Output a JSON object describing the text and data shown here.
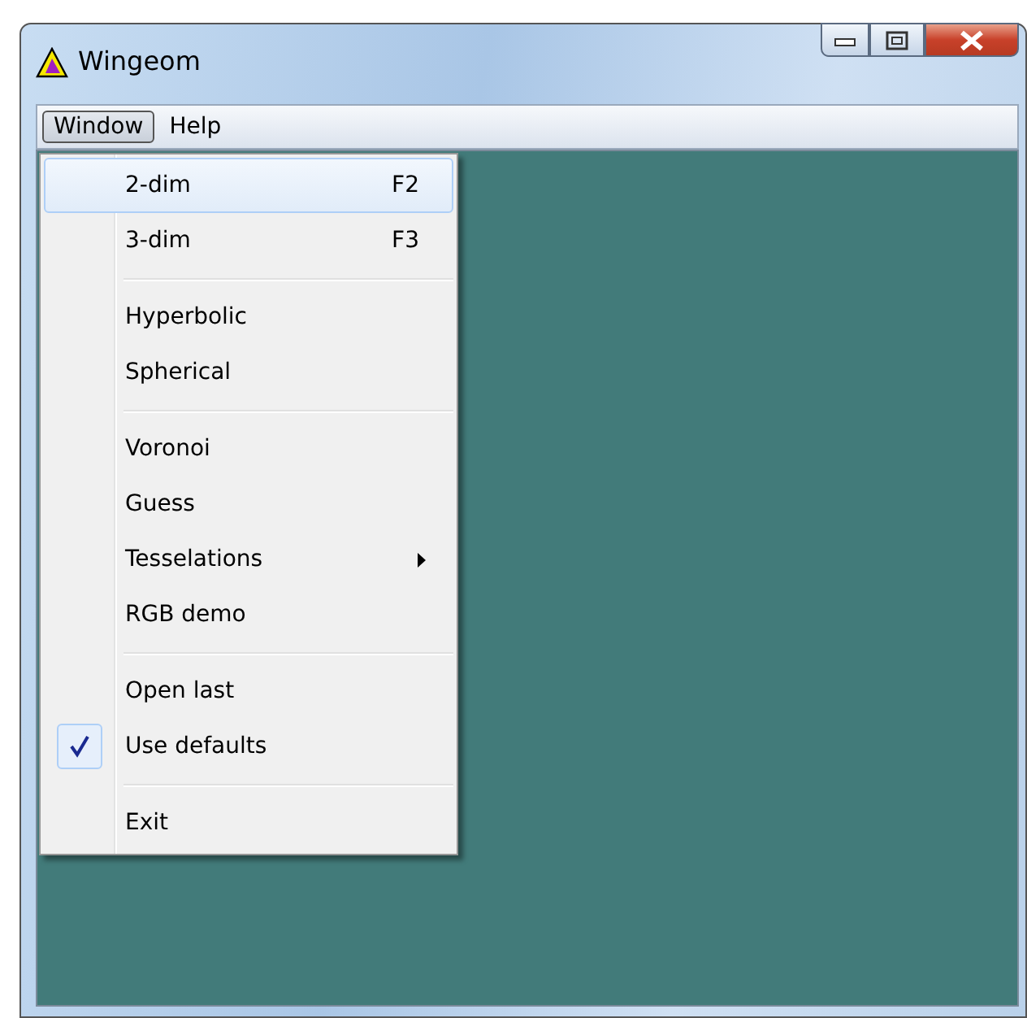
{
  "window": {
    "title": "Wingeom"
  },
  "menu_bar": [
    {
      "label": "Window",
      "selected": true
    },
    {
      "label": "Help",
      "selected": false
    }
  ],
  "dropdown": [
    {
      "kind": "item",
      "label": "2-dim",
      "shortcut": "F2",
      "selected": true,
      "checked": false,
      "submenu": false
    },
    {
      "kind": "item",
      "label": "3-dim",
      "shortcut": "F3",
      "selected": false,
      "checked": false,
      "submenu": false
    },
    {
      "kind": "separator"
    },
    {
      "kind": "item",
      "label": "Hyperbolic",
      "selected": false,
      "checked": false,
      "submenu": false
    },
    {
      "kind": "item",
      "label": "Spherical",
      "selected": false,
      "checked": false,
      "submenu": false
    },
    {
      "kind": "separator"
    },
    {
      "kind": "item",
      "label": "Voronoi",
      "selected": false,
      "checked": false,
      "submenu": false
    },
    {
      "kind": "item",
      "label": "Guess",
      "selected": false,
      "checked": false,
      "submenu": false
    },
    {
      "kind": "item",
      "label": "Tesselations",
      "selected": false,
      "checked": false,
      "submenu": true
    },
    {
      "kind": "item",
      "label": "RGB demo",
      "selected": false,
      "checked": false,
      "submenu": false
    },
    {
      "kind": "separator"
    },
    {
      "kind": "item",
      "label": "Open last",
      "selected": false,
      "checked": false,
      "submenu": false
    },
    {
      "kind": "item",
      "label": "Use defaults",
      "selected": false,
      "checked": true,
      "submenu": false
    },
    {
      "kind": "separator"
    },
    {
      "kind": "item",
      "label": "Exit",
      "selected": false,
      "checked": false,
      "submenu": false
    }
  ]
}
